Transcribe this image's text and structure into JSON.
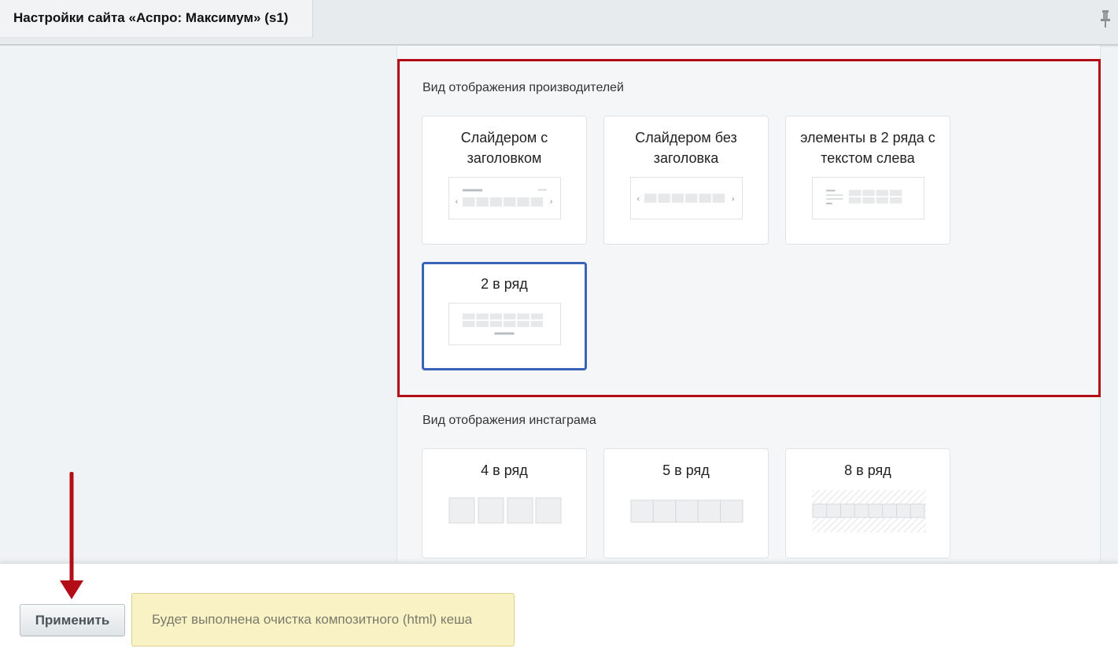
{
  "header": {
    "title": "Настройки сайта «Аспро: Максимум» (s1)",
    "pin_icon": "pin-icon"
  },
  "manufacturers_section": {
    "title": "Вид отображения производителей",
    "options": [
      {
        "label": "Слайдером с заголовком",
        "selected": false
      },
      {
        "label": "Слайдером без заголовка",
        "selected": false
      },
      {
        "label": "элементы в 2 ряда с текстом слева",
        "selected": false
      },
      {
        "label": "2 в ряд",
        "selected": true
      }
    ]
  },
  "instagram_section": {
    "title": "Вид отображения инстаграма",
    "options": [
      {
        "label": "4 в ряд"
      },
      {
        "label": "5 в ряд"
      },
      {
        "label": "8 в ряд"
      }
    ]
  },
  "footer": {
    "apply_label": "Применить",
    "notice": "Будет выполнена очистка композитного (html) кеша"
  },
  "colors": {
    "highlight": "#b30e17",
    "selected_border": "#3a62b8",
    "arrow": "#b30e17",
    "notice_bg": "#f9f2c4"
  }
}
